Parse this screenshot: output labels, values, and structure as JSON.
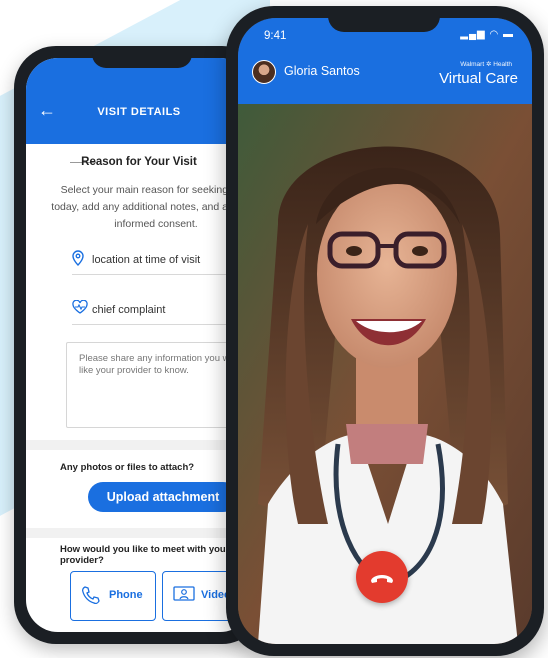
{
  "visit_details": {
    "header_title": "VISIT DETAILS",
    "section_title": "Reason for Your Visit",
    "description": "Select your main reason for seeking care today, add any additional notes, and agree to informed consent.",
    "location_label": "location at time of visit",
    "complaint_label": "chief complaint",
    "notes_placeholder": "Please share any information you would like your provider to know.",
    "attach_question": "Any photos or files to attach?",
    "upload_button": "Upload attachment",
    "meet_question": "How would you like to meet with your provider?",
    "options": [
      {
        "label": "Phone",
        "icon": "phone-icon"
      },
      {
        "label": "Video",
        "icon": "video-icon"
      }
    ]
  },
  "virtual_care": {
    "time": "9:41",
    "status": "▂▄▆ ◠ ▬",
    "caller_name": "Gloria Santos",
    "brand_small": "Walmart ✲ Health",
    "brand": "Virtual Care",
    "end_call_icon": "end-call-icon"
  },
  "colors": {
    "brand_blue": "#1a6fe0",
    "end_call_red": "#e33b2e",
    "background_tint": "#d8f0fb"
  }
}
